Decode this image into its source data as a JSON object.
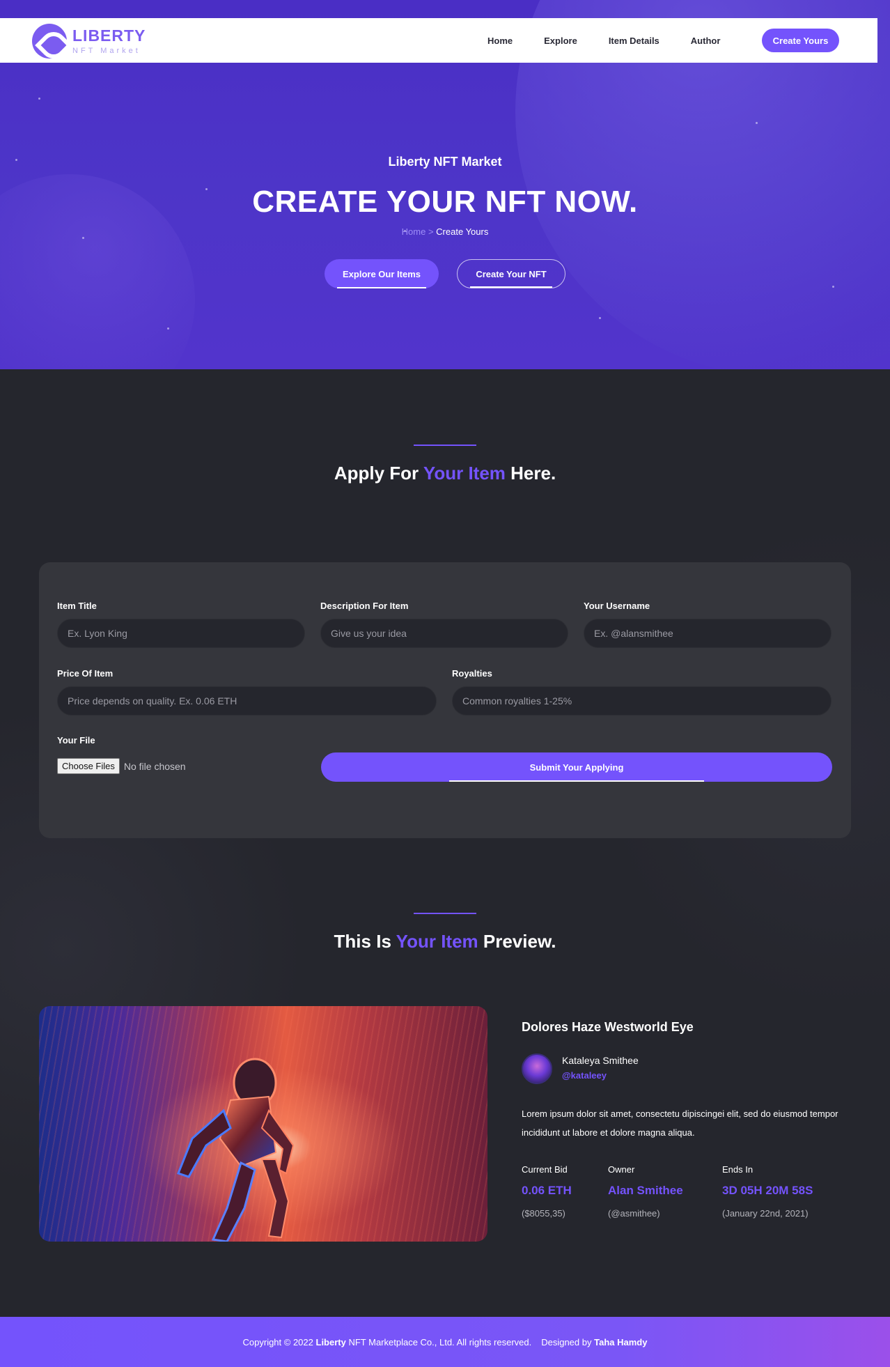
{
  "brand": {
    "name": "LIBERTY",
    "tagline": "NFT Market",
    "color": "#7453fc"
  },
  "nav": {
    "links": [
      "Home",
      "Explore",
      "Item Details",
      "Author"
    ],
    "cta": "Create Yours"
  },
  "hero": {
    "kicker": "Liberty NFT Market",
    "title": "CREATE YOUR NFT NOW.",
    "breadcrumb": {
      "home": "Home",
      "separator": ">",
      "current": "Create Yours"
    },
    "buttons": {
      "primary": "Explore Our Items",
      "secondary": "Create Your NFT"
    }
  },
  "apply": {
    "title_pre": "Apply For",
    "title_accent": "Your Item",
    "title_post": "Here.",
    "fields": {
      "item_title": {
        "label": "Item Title",
        "placeholder": "Ex. Lyon King"
      },
      "description": {
        "label": "Description For Item",
        "placeholder": "Give us your idea"
      },
      "username": {
        "label": "Your Username",
        "placeholder": "Ex. @alansmithee"
      },
      "price": {
        "label": "Price Of Item",
        "placeholder": "Price depends on quality. Ex. 0.06 ETH"
      },
      "royalties": {
        "label": "Royalties",
        "placeholder": "Common royalties 1-25%"
      },
      "file": {
        "label": "Your File",
        "button": "Choose Files",
        "status": "No file chosen"
      }
    },
    "submit": "Submit Your Applying"
  },
  "preview": {
    "title_pre": "This Is",
    "title_accent": "Your Item",
    "title_post": "Preview.",
    "item_name": "Dolores Haze Westworld Eye",
    "creator": {
      "name": "Kataleya Smithee",
      "handle": "@kataleey"
    },
    "description": "Lorem ipsum dolor sit amet, consectetu dipiscingei elit, sed do eiusmod tempor incididunt ut labore et dolore magna aliqua.",
    "stats": {
      "bid": {
        "label": "Current Bid",
        "value": "0.06 ETH",
        "sub": "($8055,35)"
      },
      "owner": {
        "label": "Owner",
        "value": "Alan Smithee",
        "sub": "(@asmithee)"
      },
      "ends": {
        "label": "Ends In",
        "value": "3D 05H 20M 58S",
        "sub": "(January 22nd, 2021)"
      }
    }
  },
  "footer": {
    "copyright_pre": "Copyright © 2022",
    "company": "Liberty",
    "copyright_post": "NFT Marketplace Co., Ltd. All rights reserved.",
    "designed_pre": "Designed by",
    "designer": "Taha Hamdy"
  }
}
